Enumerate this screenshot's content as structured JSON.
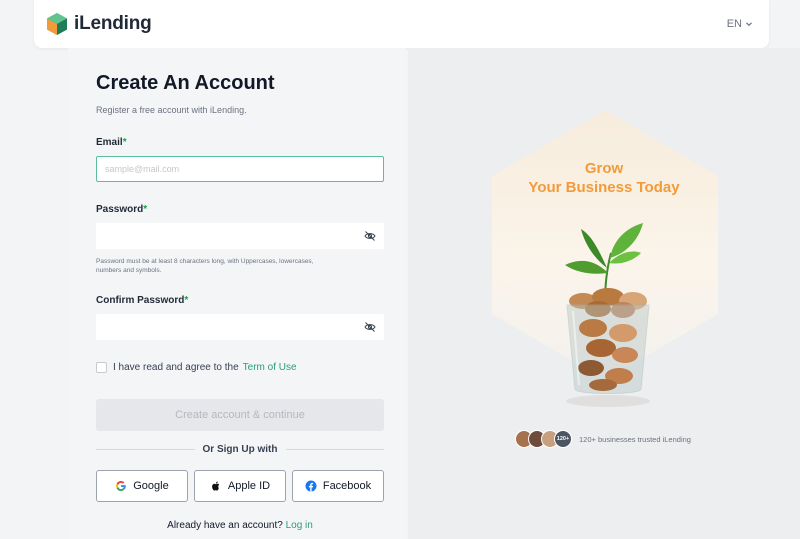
{
  "header": {
    "brand": "iLending",
    "language": "EN"
  },
  "form": {
    "title": "Create An Account",
    "subtitle": "Register a free account with iLending.",
    "email_label": "Email",
    "email_placeholder": "sample@mail.com",
    "password_label": "Password",
    "password_hint": "Password must be at least 8 characters long, with Uppercases, lowercases, numbers and symbols.",
    "confirm_label": "Confirm Password",
    "required_mark": "*",
    "agree_text": "I have read and agree to the",
    "terms_link": "Term of Use",
    "submit_label": "Create account & continue",
    "divider_text": "Or Sign Up with",
    "social": {
      "google": "Google",
      "apple": "Apple ID",
      "facebook": "Facebook"
    },
    "have_account": "Already have an account?",
    "login_link": "Log in"
  },
  "promo": {
    "headline_1": "Grow",
    "headline_2": "Your Business Today",
    "avatar_count": "120+",
    "trusted_text": "120+ businesses trusted iLending"
  },
  "colors": {
    "accent": "#2a9d78",
    "orange": "#f29b3a",
    "focus_border": "#5bbf9e"
  }
}
